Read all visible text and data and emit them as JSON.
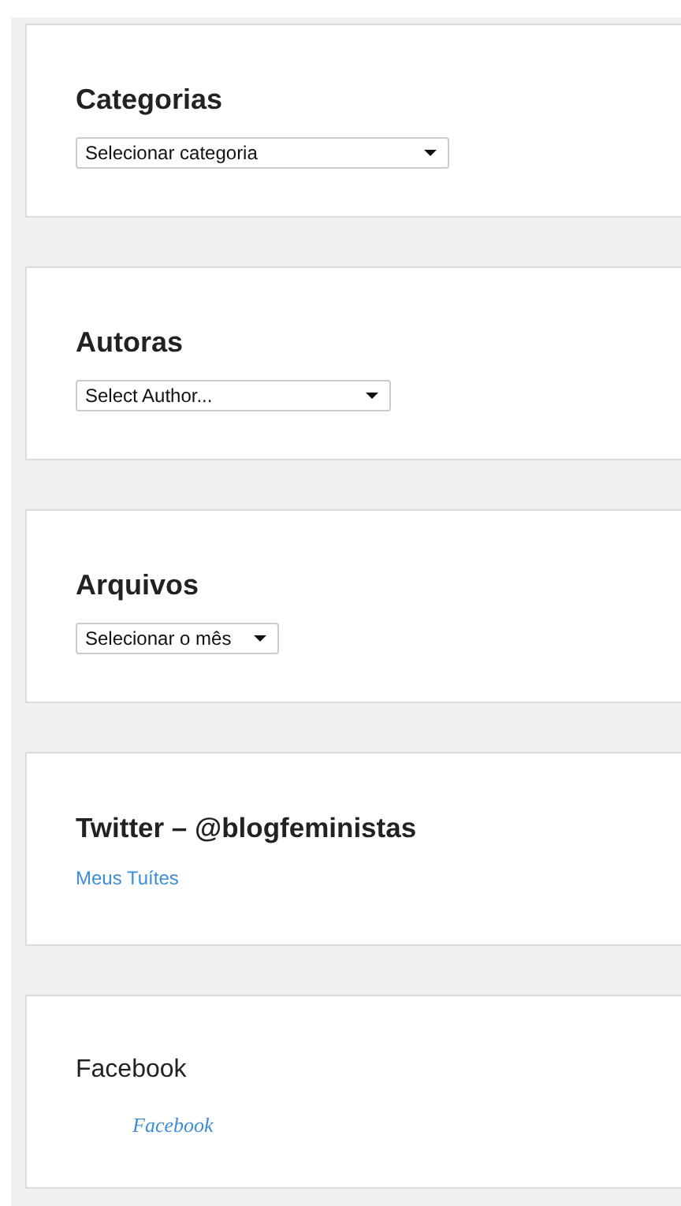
{
  "widgets": [
    {
      "title": "Categorias",
      "bold_title": true,
      "kind": "dropdown",
      "text": "Selecionar categoria"
    },
    {
      "title": "Autoras",
      "bold_title": true,
      "kind": "dropdown",
      "text": "Select Author..."
    },
    {
      "title": "Arquivos",
      "bold_title": true,
      "kind": "dropdown",
      "text": "Selecionar o mês"
    },
    {
      "title": "Twitter – @blogfeministas",
      "bold_title": true,
      "kind": "link",
      "text": "Meus Tuítes"
    },
    {
      "title": "Facebook",
      "bold_title": false,
      "kind": "embed",
      "text": "Facebook"
    }
  ]
}
